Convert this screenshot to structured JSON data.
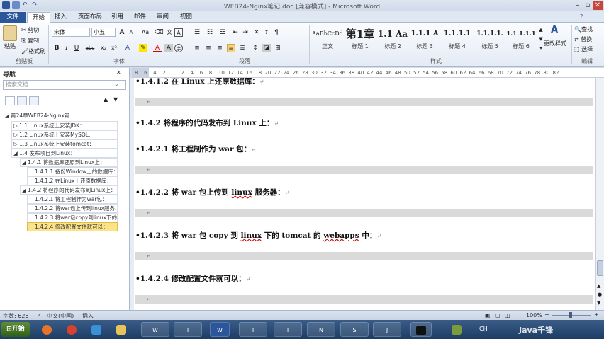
{
  "window": {
    "title": "WEB24-Nginx笔记.doc [兼容模式] - Microsoft Word"
  },
  "tabs": [
    "文件",
    "开始",
    "插入",
    "页面布局",
    "引用",
    "邮件",
    "审阅",
    "视图"
  ],
  "ribbon": {
    "clipboard": {
      "paste": "粘贴",
      "cut": "剪切",
      "copy": "复制",
      "format_painter": "格式刷",
      "label": "剪贴板"
    },
    "font": {
      "name": "宋体",
      "size": "小五",
      "label": "字体",
      "grow": "A",
      "shrink": "A",
      "case": "Aa",
      "bold": "B",
      "italic": "I",
      "underline": "U",
      "strike": "abc",
      "sub": "x₂",
      "sup": "x²"
    },
    "paragraph": {
      "label": "段落"
    },
    "styles": {
      "label": "样式",
      "items": [
        {
          "preview": "AaBbCcDd",
          "name": "正文"
        },
        {
          "preview": "第1章",
          "name": "标题 1"
        },
        {
          "preview": "1.1 Aa",
          "name": "标题 2"
        },
        {
          "preview": "1.1.1 A",
          "name": "标题 3"
        },
        {
          "preview": "1.1.1.1",
          "name": "标题 4"
        },
        {
          "preview": "1.1.1.1.",
          "name": "标题 5"
        },
        {
          "preview": "1.1.1.1.1",
          "name": "标题 6"
        }
      ],
      "change_styles": "更改样式"
    },
    "editing": {
      "find": "查找",
      "replace": "替换",
      "select": "选择",
      "label": "编辑"
    }
  },
  "nav": {
    "title": "导航",
    "search_placeholder": "搜索文档",
    "tree": [
      {
        "label": "第24章WEB24-Nginx篇",
        "level": 0
      },
      {
        "label": "1.1 Linux系统上安装JDK：",
        "level": 1
      },
      {
        "label": "1.2 Linux系统上安装MySQL:",
        "level": 1
      },
      {
        "label": "1.3 Linux系统上安装tomcat：",
        "level": 1
      },
      {
        "label": "1.4 发布项目到Linux：",
        "level": 1
      },
      {
        "label": "1.4.1 将数据库还原到Linux上：",
        "level": 2
      },
      {
        "label": "1.4.1.1 备份Window上的数据库：",
        "level": 3
      },
      {
        "label": "1.4.1.2 在Linux上还原数据库：",
        "level": 3
      },
      {
        "label": "1.4.2 将程序的代码发布到Linux上：",
        "level": 2
      },
      {
        "label": "1.4.2.1 将工程制作为war包：",
        "level": 3
      },
      {
        "label": "1.4.2.2 将war包上传到linux服务...",
        "level": 3
      },
      {
        "label": "1.4.2.3 将war包copy到linux下的...",
        "level": 3
      },
      {
        "label": "1.4.2.4 修改配置文件就可以：",
        "level": 3
      }
    ]
  },
  "ruler": [
    "8",
    "6",
    "4",
    "2",
    "",
    "2",
    "4",
    "6",
    "8",
    "10",
    "12",
    "14",
    "16",
    "18",
    "20",
    "22",
    "24",
    "26",
    "28",
    "30",
    "32",
    "34",
    "36",
    "38",
    "40",
    "42",
    "44",
    "46",
    "48",
    "50",
    "52",
    "54",
    "56",
    "58",
    "60",
    "62",
    "64",
    "66",
    "68",
    "70",
    "72",
    "74",
    "76",
    "78",
    "80",
    "82"
  ],
  "document": {
    "h_top": "1.4.1.2 在 Linux 上还原数据库：",
    "h1": "1.4.2  将程序的代码发布到 Linux 上：",
    "h2": "1.4.2.1 将工程制作为 war 包：",
    "h3a": "1.4.2.2 将 war 包上传到 ",
    "h3b": "linux",
    "h3c": " 服务器：",
    "h4a": "1.4.2.3 将 war 包 copy 到 ",
    "h4b": "linux",
    "h4c": " 下的 tomcat 的 ",
    "h4d": "webapps",
    "h4e": " 中：",
    "h5": "1.4.2.4 修改配置文件就可以：",
    "para_mark": "↵"
  },
  "status": {
    "words": "字数: 626",
    "lang": "中文(中国)",
    "mode": "插入",
    "zoom": "100%"
  },
  "taskbar": {
    "start": "开始",
    "items": [
      "W",
      "I",
      "W",
      "I",
      "I",
      "N",
      "S",
      "J"
    ],
    "lang": "CH",
    "clock": "",
    "watermark": "Java千锋"
  },
  "colors": {
    "accent": "#2b579a",
    "highlight": "#fbe38a"
  }
}
